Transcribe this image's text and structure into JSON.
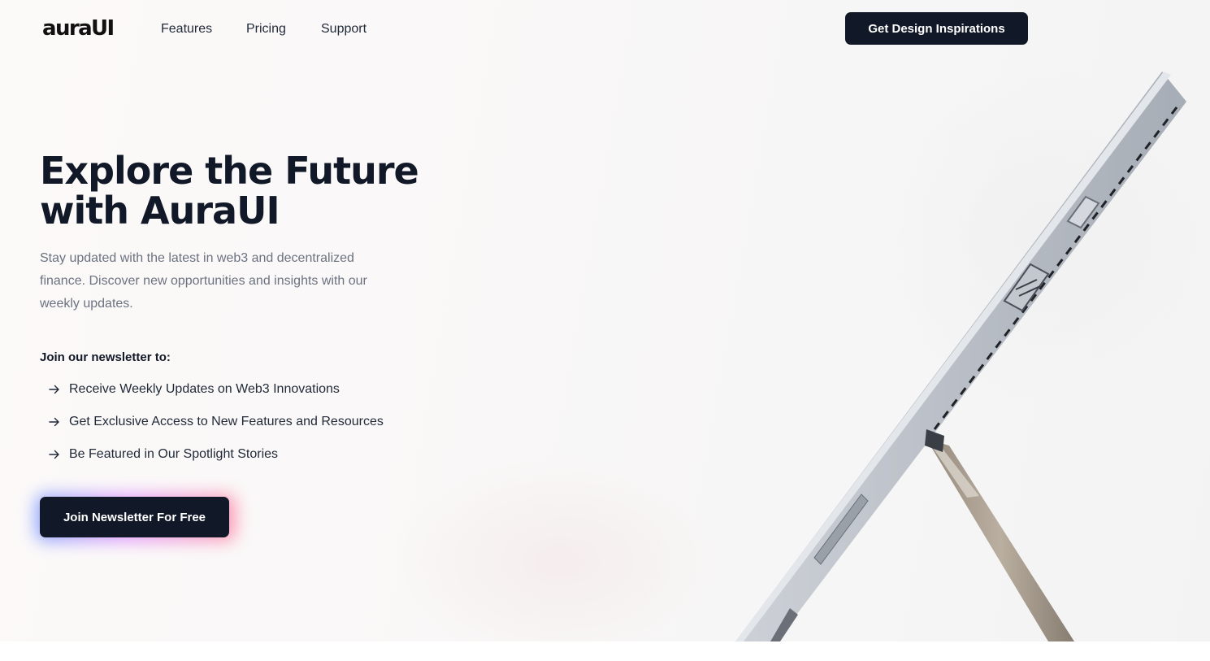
{
  "brand": {
    "logo_text": "auraUI"
  },
  "nav": {
    "links": [
      "Features",
      "Pricing",
      "Support"
    ],
    "cta_label": "Get Design Inspirations"
  },
  "hero": {
    "title_line1": "Explore the Future",
    "title_line2": "with AuraUI",
    "subtitle": "Stay updated with the latest in web3 and decentralized finance. Discover new opportunities and insights with our weekly updates.",
    "newsletter_heading": "Join our newsletter to:",
    "benefits": [
      "Receive Weekly Updates on Web3 Innovations",
      "Get Exclusive Access to New Features and Resources",
      "Be Featured in Our Spotlight Stories"
    ],
    "cta_label": "Join Newsletter For Free",
    "image": "tablet-device-side-view"
  },
  "colors": {
    "primary_dark": "#111827",
    "text_muted": "#6b7280",
    "glow_blue": "#4f7cff",
    "glow_pink": "#ff6b8b"
  }
}
